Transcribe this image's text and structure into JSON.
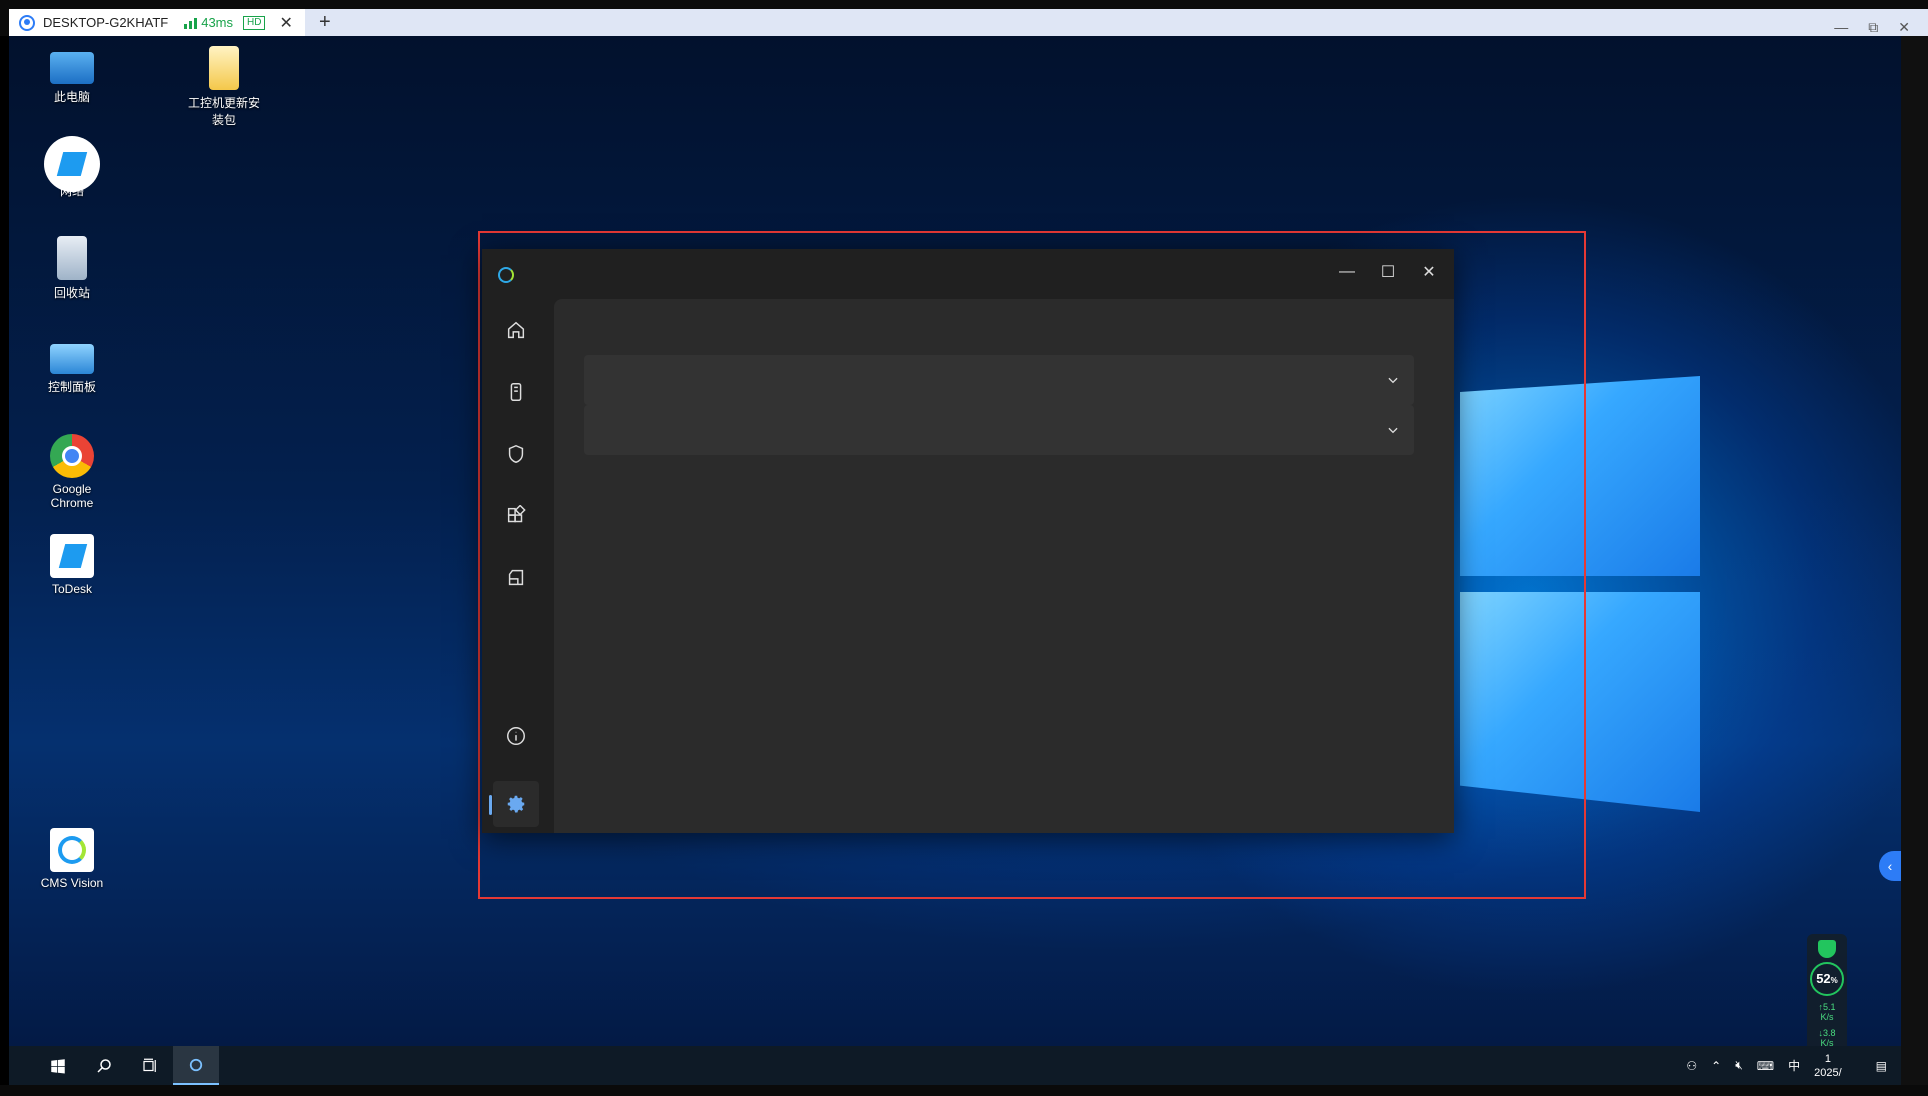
{
  "remote_tab": {
    "host": "DESKTOP-G2KHATF",
    "latency": "43ms",
    "quality": "HD",
    "close": "✕",
    "add": "+"
  },
  "window_controls": {
    "minimize": "—",
    "restore": "⧉",
    "close": "✕"
  },
  "desktop_icons": [
    {
      "label": "此电脑",
      "icon": "computer-icon"
    },
    {
      "label": "工控机更新安装包",
      "icon": "folder-icon"
    },
    {
      "label": "网络",
      "icon": "network-icon"
    },
    {
      "label": "回收站",
      "icon": "recycle-bin-icon"
    },
    {
      "label": "控制面板",
      "icon": "control-panel-icon"
    },
    {
      "label": "Google Chrome",
      "icon": "chrome-icon"
    },
    {
      "label": "ToDesk",
      "icon": "todesk-icon"
    },
    {
      "label": "CMS Vision",
      "icon": "cms-vision-icon"
    }
  ],
  "app": {
    "controls": {
      "minimize": "—",
      "maximize": "☐",
      "close": "✕"
    },
    "nav": [
      "home-icon",
      "device-icon",
      "shield-icon",
      "apps-icon",
      "storage-icon",
      "info-icon",
      "settings-icon"
    ]
  },
  "perf_widget": {
    "cpu": "52",
    "cpu_unit": "%",
    "up_rate": "5.1",
    "down_rate": "3.8",
    "rate_unit": "K/s"
  },
  "tray": {
    "ime": "中",
    "time": "1",
    "date": "2025/"
  },
  "colors": {
    "accent": "#2d7cf6",
    "app_bg": "#202020",
    "content_bg": "#2b2b2b",
    "selection": "#e53935"
  }
}
